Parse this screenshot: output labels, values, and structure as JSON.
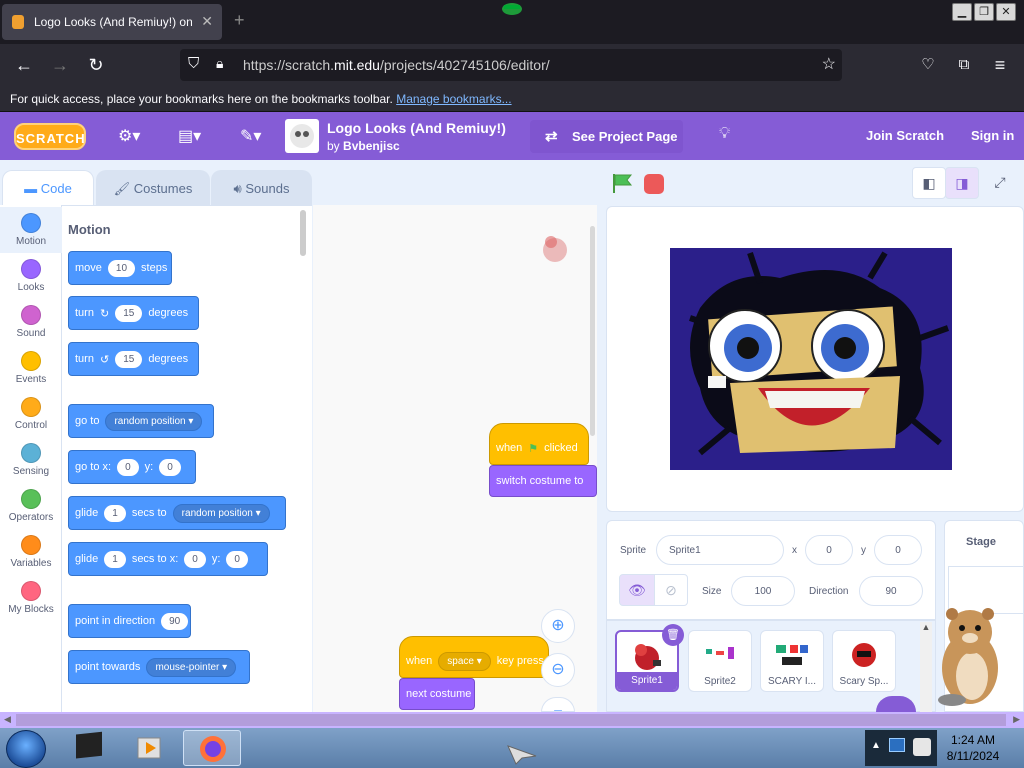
{
  "browser": {
    "tab_title": "Logo Looks (And Remiuy!) on",
    "url_prefix": "https://scratch.",
    "url_domain": "mit.edu",
    "url_path": "/projects/402745106/editor/",
    "bookmarks_text": "For quick access, place your bookmarks here on the bookmarks toolbar.",
    "bookmarks_link": "Manage bookmarks..."
  },
  "scratch": {
    "logo_text": "SCRATCH",
    "project_title": "Logo Looks (And Remiuy!)",
    "by_label": "by",
    "author": "Bvbenjisc",
    "see_project": "See Project Page",
    "join": "Join Scratch",
    "sign_in": "Sign in"
  },
  "tabs": {
    "code": "Code",
    "costumes": "Costumes",
    "sounds": "Sounds"
  },
  "categories": [
    {
      "label": "Motion",
      "color": "#4c97ff"
    },
    {
      "label": "Looks",
      "color": "#9966ff"
    },
    {
      "label": "Sound",
      "color": "#cf63cf"
    },
    {
      "label": "Events",
      "color": "#ffbf00"
    },
    {
      "label": "Control",
      "color": "#ffab19"
    },
    {
      "label": "Sensing",
      "color": "#5cb1d6"
    },
    {
      "label": "Operators",
      "color": "#59c059"
    },
    {
      "label": "Variables",
      "color": "#ff8c1a"
    },
    {
      "label": "My Blocks",
      "color": "#ff6680"
    }
  ],
  "palette": {
    "heading": "Motion",
    "move": {
      "a": "move",
      "n": "10",
      "b": "steps"
    },
    "turn_right": {
      "a": "turn",
      "n": "15",
      "b": "degrees"
    },
    "turn_left": {
      "a": "turn",
      "n": "15",
      "b": "degrees"
    },
    "goto": {
      "a": "go to",
      "d": "random position"
    },
    "gotoxy": {
      "a": "go to x:",
      "x": "0",
      "b": "y:",
      "y": "0"
    },
    "glide": {
      "a": "glide",
      "n": "1",
      "b": "secs to",
      "d": "random position"
    },
    "glidexy": {
      "a": "glide",
      "n": "1",
      "b": "secs to x:",
      "x": "0",
      "c": "y:",
      "y": "0"
    },
    "point_dir": {
      "a": "point in direction",
      "n": "90"
    },
    "point_towards": {
      "a": "point towards",
      "d": "mouse-pointer"
    }
  },
  "script": {
    "when_flag": {
      "a": "when",
      "b": "clicked"
    },
    "switch_costume": "switch costume to",
    "when_key": {
      "a": "when",
      "d": "space",
      "b": "key press"
    },
    "next_costume": "next costume"
  },
  "sprite_info": {
    "sprite_label": "Sprite",
    "sprite_name": "Sprite1",
    "x_label": "x",
    "x": "0",
    "y_label": "y",
    "y": "0",
    "size_label": "Size",
    "size": "100",
    "dir_label": "Direction",
    "dir": "90"
  },
  "sprites": [
    {
      "name": "Sprite1"
    },
    {
      "name": "Sprite2"
    },
    {
      "name": "SCARY I..."
    },
    {
      "name": "Scary Sp..."
    }
  ],
  "stage_label": "Stage",
  "taskbar": {
    "time": "1:24 AM",
    "date": "8/11/2024"
  }
}
